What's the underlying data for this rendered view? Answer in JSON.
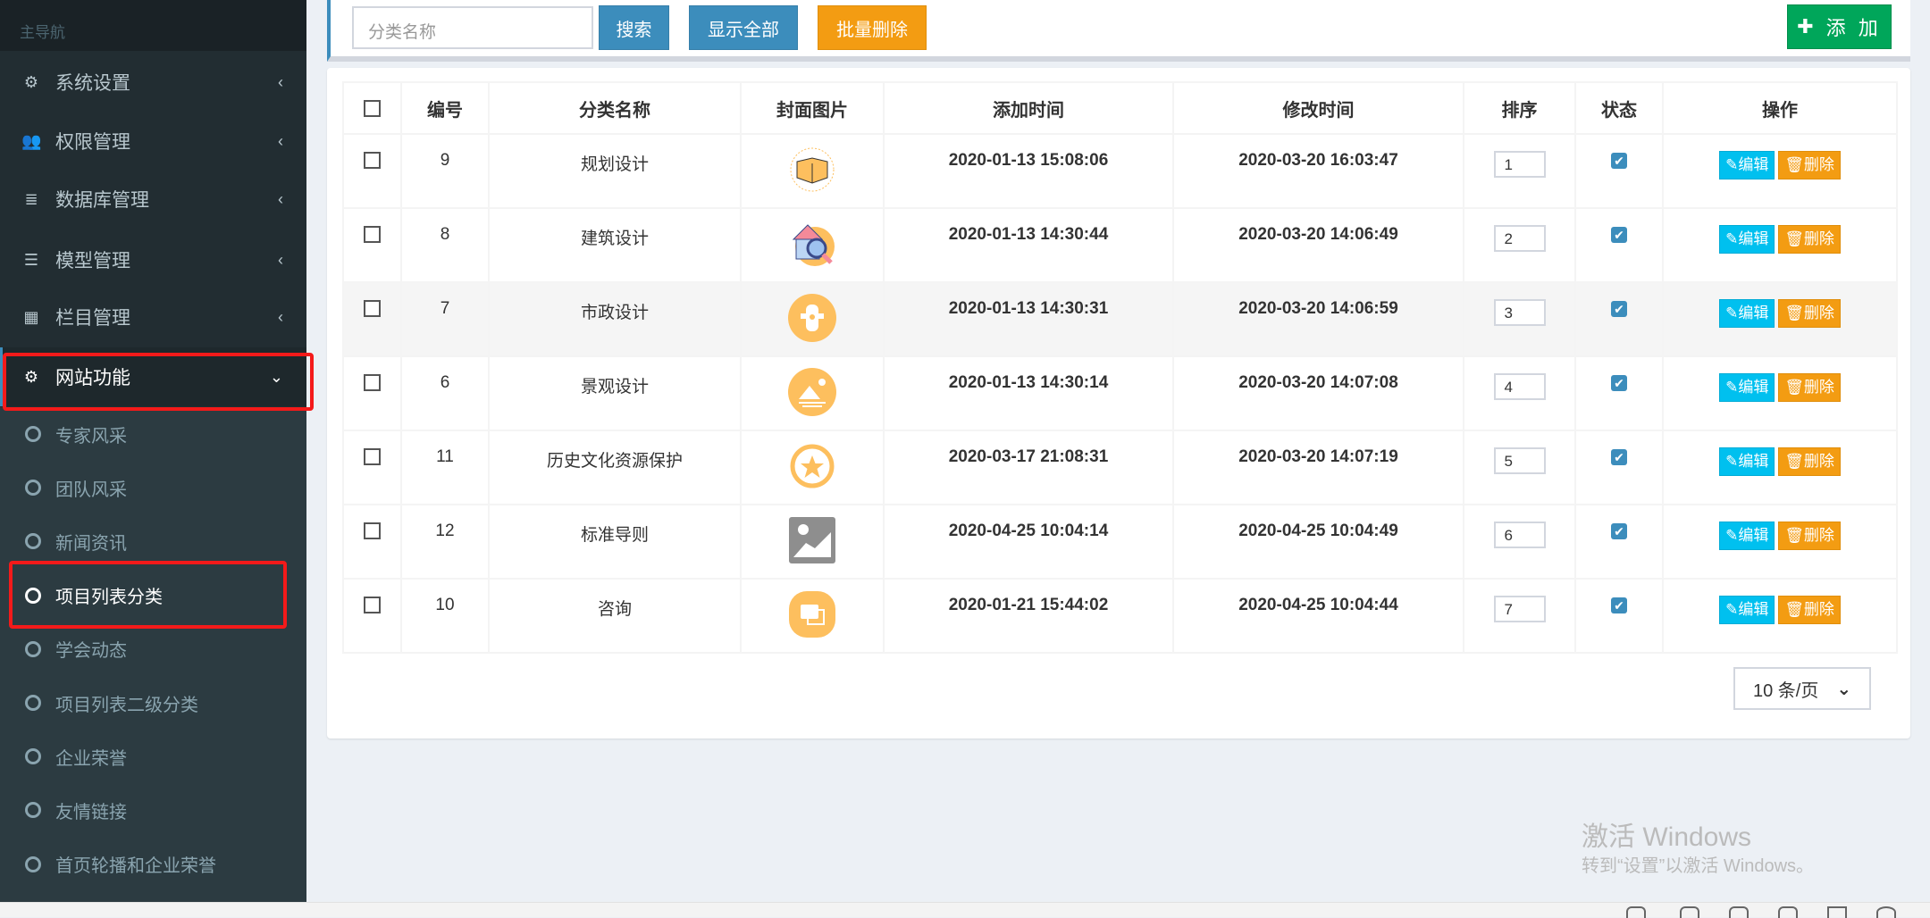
{
  "sidebar": {
    "header": "主导航",
    "items": [
      {
        "label": "系统设置",
        "icon": "cogs-icon"
      },
      {
        "label": "权限管理",
        "icon": "users-icon"
      },
      {
        "label": "数据库管理",
        "icon": "database-icon"
      },
      {
        "label": "模型管理",
        "icon": "list-icon"
      },
      {
        "label": "栏目管理",
        "icon": "grid-icon"
      },
      {
        "label": "网站功能",
        "icon": "gear-icon"
      }
    ],
    "submenu": [
      "专家风采",
      "团队风采",
      "新闻资讯",
      "项目列表分类",
      "学会动态",
      "项目列表二级分类",
      "企业荣誉",
      "友情链接",
      "首页轮播和企业荣誉"
    ]
  },
  "toolbar": {
    "search_placeholder": "分类名称",
    "search": "搜索",
    "show_all": "显示全部",
    "batch_delete": "批量删除",
    "add": "添 加"
  },
  "table": {
    "headers": [
      "编号",
      "分类名称",
      "封面图片",
      "添加时间",
      "修改时间",
      "排序",
      "状态",
      "操作"
    ],
    "edit": "编辑",
    "delete": "删除",
    "rows": [
      {
        "id": "9",
        "name": "规划设计",
        "img": "planning",
        "added": "2020-01-13 15:08:06",
        "modified": "2020-03-20 16:03:47",
        "sort": "1"
      },
      {
        "id": "8",
        "name": "建筑设计",
        "img": "house",
        "added": "2020-01-13 14:30:44",
        "modified": "2020-03-20 14:06:49",
        "sort": "2"
      },
      {
        "id": "7",
        "name": "市政设计",
        "img": "hydrant",
        "added": "2020-01-13 14:30:31",
        "modified": "2020-03-20 14:06:59",
        "sort": "3"
      },
      {
        "id": "6",
        "name": "景观设计",
        "img": "landscape",
        "added": "2020-01-13 14:30:14",
        "modified": "2020-03-20 14:07:08",
        "sort": "4"
      },
      {
        "id": "11",
        "name": "历史文化资源保护",
        "img": "star",
        "added": "2020-03-17 21:08:31",
        "modified": "2020-03-20 14:07:19",
        "sort": "5"
      },
      {
        "id": "12",
        "name": "标准导则",
        "img": "placeholder",
        "added": "2020-04-25 10:04:14",
        "modified": "2020-04-25 10:04:49",
        "sort": "6"
      },
      {
        "id": "10",
        "name": "咨询",
        "img": "chat",
        "added": "2020-01-21 15:44:02",
        "modified": "2020-04-25 10:04:44",
        "sort": "7"
      }
    ]
  },
  "pager": {
    "page_size": "10 条/页"
  },
  "watermark": {
    "title": "激活 Windows",
    "subtitle": "转到“设置”以激活 Windows。"
  },
  "colors": {
    "sidebar": "#222d32",
    "primary": "#3c8dbc",
    "warning": "#f39c12",
    "success": "#00a65a",
    "info": "#00c0ef",
    "highlight": "#f41a1a"
  }
}
